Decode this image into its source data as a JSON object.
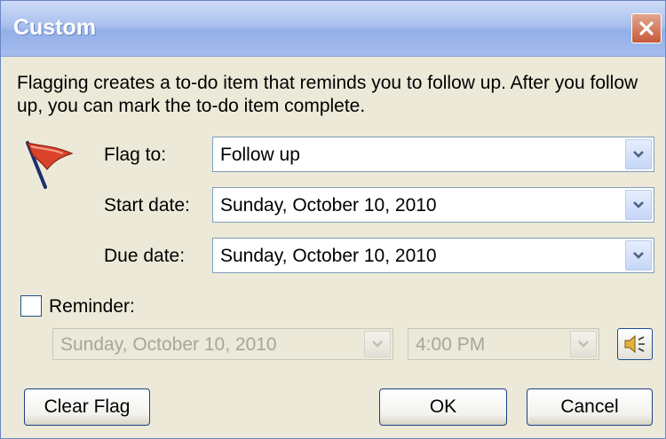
{
  "window": {
    "title": "Custom"
  },
  "description": "Flagging creates a to-do item that reminds you to follow up. After you follow up, you can mark the to-do item complete.",
  "fields": {
    "flag_to": {
      "label": "Flag to:",
      "value": "Follow up"
    },
    "start_date": {
      "label": "Start date:",
      "value": "Sunday, October 10, 2010"
    },
    "due_date": {
      "label": "Due date:",
      "value": "Sunday, October 10, 2010"
    }
  },
  "reminder": {
    "label": "Reminder:",
    "checked": false,
    "date": "Sunday, October 10, 2010",
    "time": "4:00 PM"
  },
  "buttons": {
    "clear_flag": "Clear Flag",
    "ok": "OK",
    "cancel": "Cancel"
  },
  "colors": {
    "title_bar": "#a9c0ee",
    "close_button": "#c65a39",
    "flag": "#d9432a",
    "dialog_bg": "#ECE9D8"
  },
  "icons": {
    "flag": "red-flag-icon",
    "reminder_sound": "speaker-icon",
    "close": "close-icon",
    "dropdown": "chevron-down-icon"
  }
}
